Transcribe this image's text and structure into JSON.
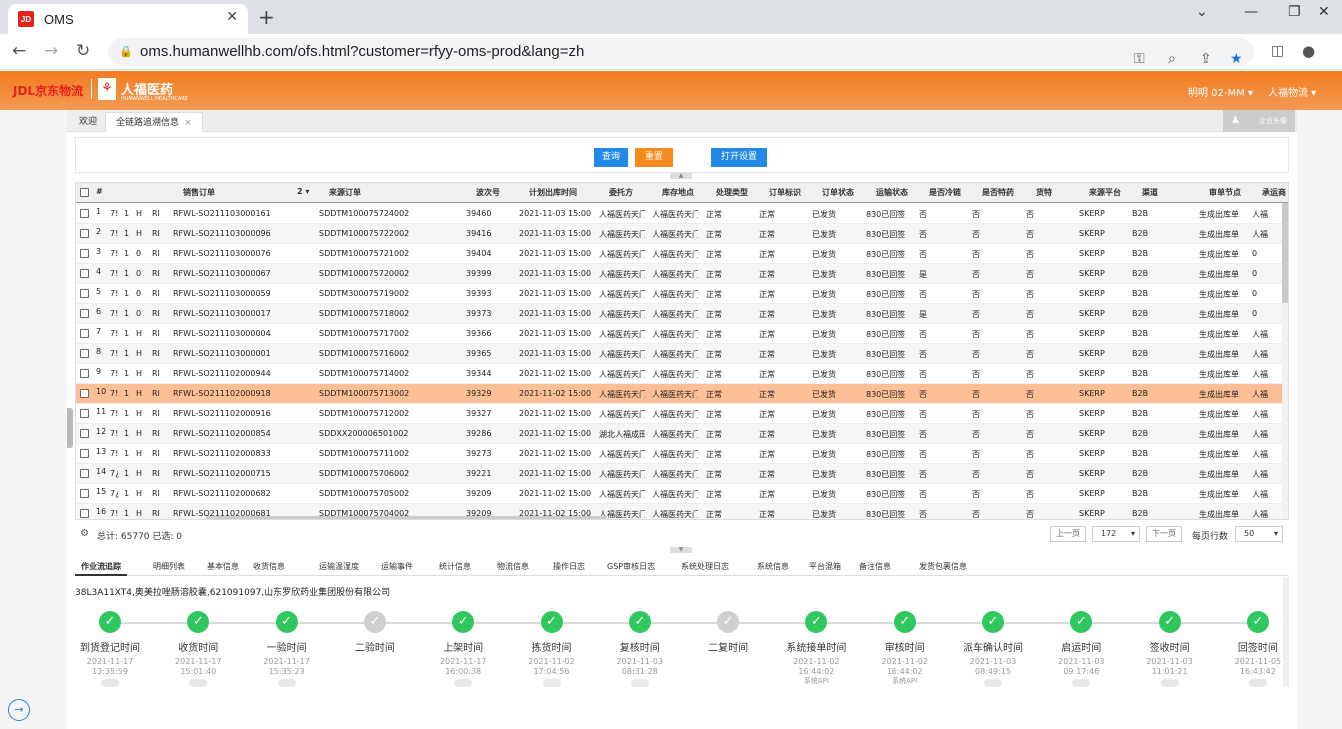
{
  "browser": {
    "tab_title": "OMS",
    "favicon_text": "JD",
    "url": "oms.humanwellhb.com/ofs.html?customer=rfyy-oms-prod&lang=zh"
  },
  "header": {
    "logo_jdl": "JDL京东物流",
    "logo_hf": "人福医药",
    "logo_hf_sub": "HUMANWELL HEALTHCARE",
    "user": "明明 02-MM ▾",
    "org": "人福物流 ▾"
  },
  "tabs": {
    "welcome": "欢迎",
    "trace": "全链路追溯信息",
    "corp": "企业头像"
  },
  "buttons": {
    "query": "查询",
    "reset": "重置",
    "settings": "打开设置"
  },
  "columns": {
    "num": "#",
    "sales_order": "销售订单",
    "sort": "2 ▾",
    "source_order": "来源订单",
    "wave": "波次号",
    "plan_time": "计划出库时间",
    "consignor": "委托方",
    "warehouse": "库存地点",
    "process_type": "处理类型",
    "order_flag": "订单标识",
    "order_status": "订单状态",
    "transport_status": "运输状态",
    "cold_chain": "是否冷链",
    "special": "是否特药",
    "goods": "货特",
    "platform": "来源平台",
    "channel": "渠道",
    "audit": "审单节点",
    "carrier": "承运商"
  },
  "rows": [
    {
      "n": "1",
      "a": "7!",
      "b": "1",
      "c": "H",
      "d": "RI",
      "so": "RFWL-SO211103000161",
      "src": "SDDTM100075724002",
      "wave": "39460",
      "time": "2021-11-03 15:00",
      "cons": "人福医药天门",
      "wh": "人福医药天门",
      "pt": "正常",
      "of": "正常",
      "os": "已发货",
      "ts": "830已回签",
      "cold": "否",
      "sp": "否",
      "gd": "否",
      "pf": "SKERP",
      "ch": "B2B",
      "au": "生成出库单",
      "ca": "人福"
    },
    {
      "n": "2",
      "a": "7!",
      "b": "1",
      "c": "H",
      "d": "RI",
      "so": "RFWL-SO211103000096",
      "src": "SDDTM100075722002",
      "wave": "39416",
      "time": "2021-11-03 15:00",
      "cons": "人福医药天门",
      "wh": "人福医药天门",
      "pt": "正常",
      "of": "正常",
      "os": "已发货",
      "ts": "830已回签",
      "cold": "否",
      "sp": "否",
      "gd": "否",
      "pf": "SKERP",
      "ch": "B2B",
      "au": "生成出库单",
      "ca": "人福"
    },
    {
      "n": "3",
      "a": "7!",
      "b": "1",
      "c": "0",
      "d": "RI",
      "so": "RFWL-SO211103000076",
      "src": "SDDTM100075721002",
      "wave": "39404",
      "time": "2021-11-03 15:00",
      "cons": "人福医药天门",
      "wh": "人福医药天门",
      "pt": "正常",
      "of": "正常",
      "os": "已发货",
      "ts": "830已回签",
      "cold": "否",
      "sp": "否",
      "gd": "否",
      "pf": "SKERP",
      "ch": "B2B",
      "au": "生成出库单",
      "ca": "0"
    },
    {
      "n": "4",
      "a": "7!",
      "b": "1",
      "c": "0",
      "d": "RI",
      "so": "RFWL-SO211103000067",
      "src": "SDDTM100075720002",
      "wave": "39399",
      "time": "2021-11-03 15:00",
      "cons": "人福医药天门",
      "wh": "人福医药天门",
      "pt": "正常",
      "of": "正常",
      "os": "已发货",
      "ts": "830已回签",
      "cold": "是",
      "sp": "否",
      "gd": "否",
      "pf": "SKERP",
      "ch": "B2B",
      "au": "生成出库单",
      "ca": "0"
    },
    {
      "n": "5",
      "a": "7!",
      "b": "1",
      "c": "0",
      "d": "RI",
      "so": "RFWL-SO211103000059",
      "src": "SDDTM300075719002",
      "wave": "39393",
      "time": "2021-11-03 15:00",
      "cons": "人福医药天门",
      "wh": "人福医药天门",
      "pt": "正常",
      "of": "正常",
      "os": "已发货",
      "ts": "830已回签",
      "cold": "否",
      "sp": "否",
      "gd": "否",
      "pf": "SKERP",
      "ch": "B2B",
      "au": "生成出库单",
      "ca": "0"
    },
    {
      "n": "6",
      "a": "7!",
      "b": "1",
      "c": "0",
      "d": "RI",
      "so": "RFWL-SO211103000017",
      "src": "SDDTM100075718002",
      "wave": "39373",
      "time": "2021-11-03 15:00",
      "cons": "人福医药天门",
      "wh": "人福医药天门",
      "pt": "正常",
      "of": "正常",
      "os": "已发货",
      "ts": "830已回签",
      "cold": "是",
      "sp": "否",
      "gd": "否",
      "pf": "SKERP",
      "ch": "B2B",
      "au": "生成出库单",
      "ca": "0"
    },
    {
      "n": "7",
      "a": "7!",
      "b": "1",
      "c": "H",
      "d": "RI",
      "so": "RFWL-SO211103000004",
      "src": "SDDTM100075717002",
      "wave": "39366",
      "time": "2021-11-03 15:00",
      "cons": "人福医药天门",
      "wh": "人福医药天门",
      "pt": "正常",
      "of": "正常",
      "os": "已发货",
      "ts": "830已回签",
      "cold": "否",
      "sp": "否",
      "gd": "否",
      "pf": "SKERP",
      "ch": "B2B",
      "au": "生成出库单",
      "ca": "人福"
    },
    {
      "n": "8",
      "a": "7!",
      "b": "1",
      "c": "H",
      "d": "RI",
      "so": "RFWL-SO211103000001",
      "src": "SDDTM100075716002",
      "wave": "39365",
      "time": "2021-11-03 15:00",
      "cons": "人福医药天门",
      "wh": "人福医药天门",
      "pt": "正常",
      "of": "正常",
      "os": "已发货",
      "ts": "830已回签",
      "cold": "否",
      "sp": "否",
      "gd": "否",
      "pf": "SKERP",
      "ch": "B2B",
      "au": "生成出库单",
      "ca": "人福"
    },
    {
      "n": "9",
      "a": "7!",
      "b": "1",
      "c": "H",
      "d": "RI",
      "so": "RFWL-SO211102000944",
      "src": "SDDTM100075714002",
      "wave": "39344",
      "time": "2021-11-02 15:00",
      "cons": "人福医药天门",
      "wh": "人福医药天门",
      "pt": "正常",
      "of": "正常",
      "os": "已发货",
      "ts": "830已回签",
      "cold": "否",
      "sp": "否",
      "gd": "否",
      "pf": "SKERP",
      "ch": "B2B",
      "au": "生成出库单",
      "ca": "人福"
    },
    {
      "n": "10",
      "a": "7!",
      "b": "1",
      "c": "H",
      "d": "RI",
      "so": "RFWL-SO211102000918",
      "src": "SDDTM100075713002",
      "wave": "39329",
      "time": "2021-11-02 15:00",
      "cons": "人福医药天门",
      "wh": "人福医药天门",
      "pt": "正常",
      "of": "正常",
      "os": "已发货",
      "ts": "830已回签",
      "cold": "否",
      "sp": "否",
      "gd": "否",
      "pf": "SKERP",
      "ch": "B2B",
      "au": "生成出库单",
      "ca": "人福",
      "sel": true
    },
    {
      "n": "11",
      "a": "7!",
      "b": "1",
      "c": "H",
      "d": "RI",
      "so": "RFWL-SO211102000916",
      "src": "SDDTM100075712002",
      "wave": "39327",
      "time": "2021-11-02 15:00",
      "cons": "人福医药天门",
      "wh": "人福医药天门",
      "pt": "正常",
      "of": "正常",
      "os": "已发货",
      "ts": "830已回签",
      "cold": "否",
      "sp": "否",
      "gd": "否",
      "pf": "SKERP",
      "ch": "B2B",
      "au": "生成出库单",
      "ca": "人福"
    },
    {
      "n": "12",
      "a": "7!",
      "b": "1",
      "c": "H",
      "d": "RI",
      "so": "RFWL-SO211102000854",
      "src": "SDDXX200006501002",
      "wave": "39286",
      "time": "2021-11-02 15:00",
      "cons": "湖北人福成田",
      "wh": "人福医药天门",
      "pt": "正常",
      "of": "正常",
      "os": "已发货",
      "ts": "830已回签",
      "cold": "否",
      "sp": "否",
      "gd": "否",
      "pf": "SKERP",
      "ch": "B2B",
      "au": "生成出库单",
      "ca": "人福"
    },
    {
      "n": "13",
      "a": "7!",
      "b": "1",
      "c": "H",
      "d": "RI",
      "so": "RFWL-SO211102000833",
      "src": "SDDTM100075711002",
      "wave": "39273",
      "time": "2021-11-02 15:00",
      "cons": "人福医药天门",
      "wh": "人福医药天门",
      "pt": "正常",
      "of": "正常",
      "os": "已发货",
      "ts": "830已回签",
      "cold": "否",
      "sp": "否",
      "gd": "否",
      "pf": "SKERP",
      "ch": "B2B",
      "au": "生成出库单",
      "ca": "人福"
    },
    {
      "n": "14",
      "a": "7¿",
      "b": "1",
      "c": "H",
      "d": "RI",
      "so": "RFWL-SO211102000715",
      "src": "SDDTM100075706002",
      "wave": "39221",
      "time": "2021-11-02 15:00",
      "cons": "人福医药天门",
      "wh": "人福医药天门",
      "pt": "正常",
      "of": "正常",
      "os": "已发货",
      "ts": "830已回签",
      "cold": "否",
      "sp": "否",
      "gd": "否",
      "pf": "SKERP",
      "ch": "B2B",
      "au": "生成出库单",
      "ca": "人福"
    },
    {
      "n": "15",
      "a": "7¿",
      "b": "1",
      "c": "H",
      "d": "RI",
      "so": "RFWL-SO211102000682",
      "src": "SDDTM100075705002",
      "wave": "39209",
      "time": "2021-11-02 15:00",
      "cons": "人福医药天门",
      "wh": "人福医药天门",
      "pt": "正常",
      "of": "正常",
      "os": "已发货",
      "ts": "830已回签",
      "cold": "否",
      "sp": "否",
      "gd": "否",
      "pf": "SKERP",
      "ch": "B2B",
      "au": "生成出库单",
      "ca": "人福"
    },
    {
      "n": "16",
      "a": "7!",
      "b": "1",
      "c": "H",
      "d": "RI",
      "so": "RFWL-SO211102000681",
      "src": "SDDTM100075704002",
      "wave": "39209",
      "time": "2021-11-02 15:00",
      "cons": "人福医药天门",
      "wh": "人福医药天门",
      "pt": "正常",
      "of": "正常",
      "os": "已发货",
      "ts": "830已回签",
      "cold": "否",
      "sp": "否",
      "gd": "否",
      "pf": "SKERP",
      "ch": "B2B",
      "au": "生成出库单",
      "ca": "人福"
    }
  ],
  "pager": {
    "summary": "总计:  65770 已选:  0",
    "prev": "上一页",
    "page": "172",
    "next": "下一页",
    "per_page_label": "每页行数",
    "per_page": "50"
  },
  "detail_tabs": [
    "作业流追踪",
    "明细列表",
    "基本信息",
    "收货信息",
    "运输温湿度",
    "运输事件",
    "统计信息",
    "物流信息",
    "操作日志",
    "GSP审核日志",
    "系统处理日志",
    "系统信息",
    "平台混箱",
    "备注信息",
    "发货包裹信息"
  ],
  "detail_info": "38L3A11XT4,奥美拉唑肠溶胶囊,621091097,山东罗欣药业集团股份有限公司",
  "timeline": [
    {
      "label": "到货登记时间",
      "date": "2021-11-17",
      "time": "13:35:59",
      "src": "",
      "state": "ok"
    },
    {
      "label": "收货时间",
      "date": "2021-11-17",
      "time": "15:01:40",
      "src": "",
      "state": "ok"
    },
    {
      "label": "一验时间",
      "date": "2021-11-17",
      "time": "15:35:23",
      "src": "",
      "state": "ok"
    },
    {
      "label": "二验时间",
      "date": "",
      "time": "",
      "src": "",
      "state": "pend"
    },
    {
      "label": "上架时间",
      "date": "2021-11-17",
      "time": "16:00:38",
      "src": "",
      "state": "ok"
    },
    {
      "label": "拣货时间",
      "date": "2021-11-02",
      "time": "17:04:56",
      "src": "",
      "state": "ok"
    },
    {
      "label": "复核时间",
      "date": "2021-11-03",
      "time": "08:31:28",
      "src": "",
      "state": "ok"
    },
    {
      "label": "二复时间",
      "date": "",
      "time": "",
      "src": "",
      "state": "pend"
    },
    {
      "label": "系统接单时间",
      "date": "2021-11-02",
      "time": "16:44:02",
      "src": "系统API",
      "state": "ok"
    },
    {
      "label": "审核时间",
      "date": "2021-11-02",
      "time": "16:44:02",
      "src": "系统API",
      "state": "ok"
    },
    {
      "label": "派车确认时间",
      "date": "2021-11-03",
      "time": "08:49:15",
      "src": "",
      "state": "ok"
    },
    {
      "label": "启运时间",
      "date": "2021-11-03",
      "time": "09:17:46",
      "src": "",
      "state": "ok"
    },
    {
      "label": "签收时间",
      "date": "2021-11-03",
      "time": "11:01:21",
      "src": "",
      "state": "ok"
    },
    {
      "label": "回签时间",
      "date": "2021-11-05",
      "time": "16:43:42",
      "src": "",
      "state": "ok"
    }
  ],
  "colors": {
    "header_orange": "#f27b1f",
    "selected_row": "#fdbf95",
    "btn_blue": "#2489e6",
    "btn_orange": "#f78a1d",
    "step_ok": "#2fc75e"
  }
}
